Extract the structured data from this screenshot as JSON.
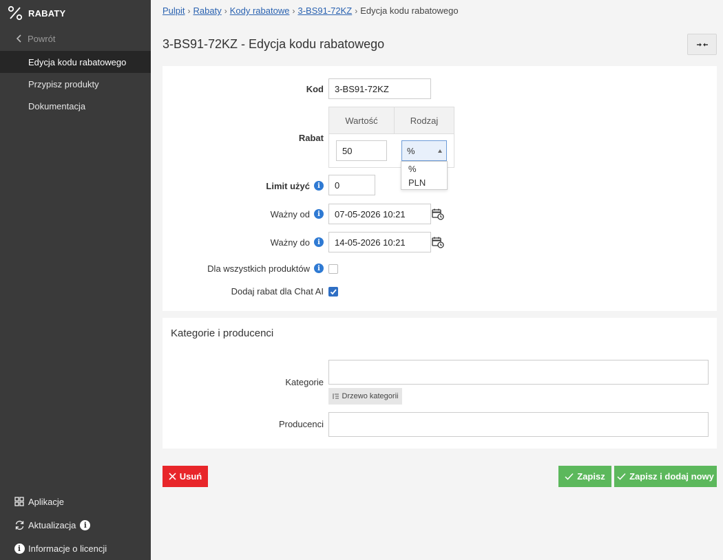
{
  "sidebar": {
    "brand": "RABATY",
    "back_label": "Powrót",
    "items": [
      {
        "label": "Edycja kodu rabatowego",
        "active": true
      },
      {
        "label": "Przypisz produkty",
        "active": false
      },
      {
        "label": "Dokumentacja",
        "active": false
      }
    ],
    "bottom": {
      "apps": "Aplikacje",
      "updates": "Aktualizacja",
      "license": "Informacje o licencji"
    }
  },
  "breadcrumb": {
    "items": [
      "Pulpit",
      "Rabaty",
      "Kody rabatowe",
      "3-BS91-72KZ"
    ],
    "current": "Edycja kodu rabatowego",
    "separator": "›"
  },
  "page_title": "3-BS91-72KZ - Edycja kodu rabatowego",
  "form": {
    "kod_label": "Kod",
    "kod_value": "3-BS91-72KZ",
    "rabat_label": "Rabat",
    "rabat_col_value": "Wartość",
    "rabat_col_type": "Rodzaj",
    "rabat_value": "50",
    "rabat_type_selected": "%",
    "rabat_type_options": [
      "%",
      "PLN"
    ],
    "limit_label": "Limit użyć",
    "limit_value": "0",
    "valid_from_label": "Ważny od",
    "valid_from_value": "07-05-2026 10:21",
    "valid_to_label": "Ważny do",
    "valid_to_value": "14-05-2026 10:21",
    "all_products_label": "Dla wszystkich produktów",
    "all_products_checked": false,
    "chat_ai_label": "Dodaj rabat dla Chat AI",
    "chat_ai_checked": true
  },
  "categories": {
    "section_title": "Kategorie i producenci",
    "categories_label": "Kategorie",
    "tree_button": "Drzewo kategorii",
    "producers_label": "Producenci"
  },
  "actions": {
    "delete": "Usuń",
    "save": "Zapisz",
    "save_new": "Zapisz i dodaj nowy"
  },
  "colors": {
    "sidebar_bg": "#3a3a3a",
    "active_item_bg": "#262626",
    "link": "#2a62b0",
    "info_icon": "#2f7ad3",
    "danger": "#e8262a",
    "success": "#5cb85c"
  }
}
